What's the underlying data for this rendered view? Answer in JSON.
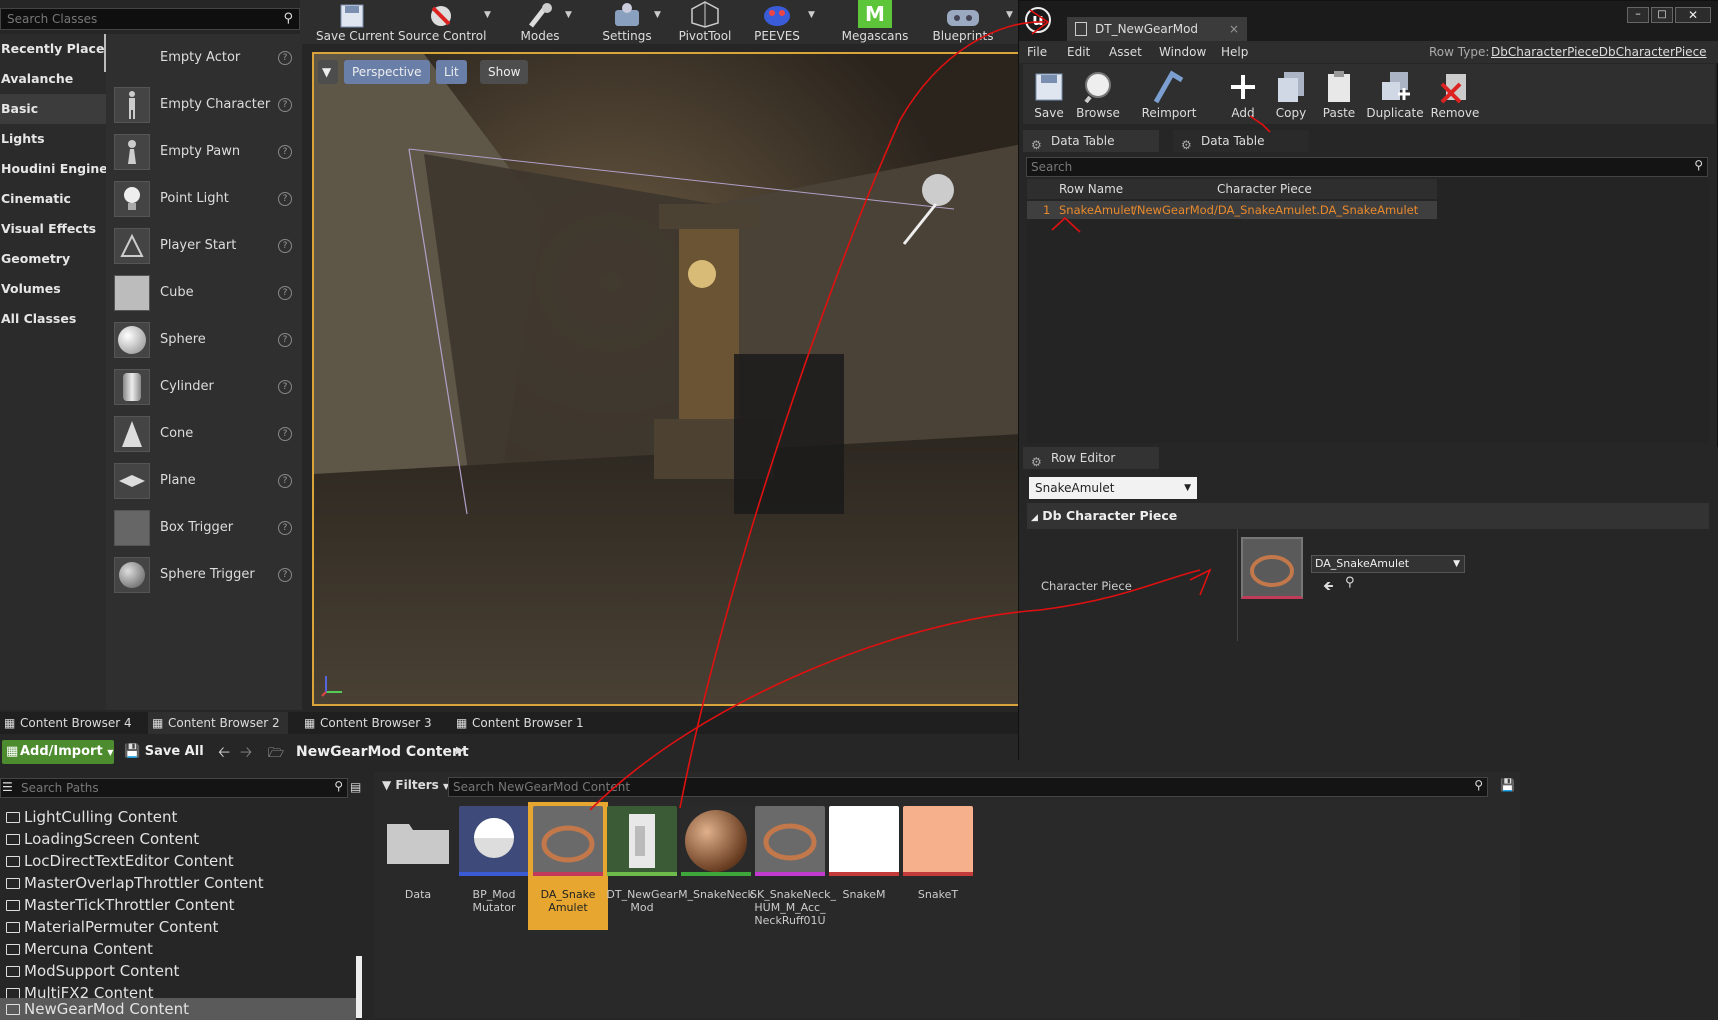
{
  "placement": {
    "search_placeholder": "Search Classes",
    "categories": [
      "Recently Placed",
      "Avalanche",
      "Basic",
      "Lights",
      "Houdini Engine",
      "Cinematic",
      "Visual Effects",
      "Geometry",
      "Volumes",
      "All Classes"
    ],
    "selected_category": "Basic",
    "items": [
      "Empty Actor",
      "Empty Character",
      "Empty Pawn",
      "Point Light",
      "Player Start",
      "Cube",
      "Sphere",
      "Cylinder",
      "Cone",
      "Plane",
      "Box Trigger",
      "Sphere Trigger"
    ]
  },
  "toolbar": {
    "save_current": "Save Current",
    "source_control": "Source Control",
    "modes": "Modes",
    "settings": "Settings",
    "pivot_tool": "PivotTool",
    "peeves": "PEEVES",
    "megascans": "Megascans",
    "blueprints": "Blueprints"
  },
  "viewport": {
    "perspective": "Perspective",
    "lit": "Lit",
    "show": "Show"
  },
  "data_table_window": {
    "tab_title": "DT_NewGearMod",
    "menus": [
      "File",
      "Edit",
      "Asset",
      "Window",
      "Help"
    ],
    "row_type_label": "Row Type:",
    "row_type_value": "DbCharacterPieceDbCharacterPiece",
    "buttons": [
      "Save",
      "Browse",
      "Reimport",
      "Add",
      "Copy",
      "Paste",
      "Duplicate",
      "Remove"
    ],
    "tab_data_table": "Data Table",
    "tab_details": "Data Table Details",
    "search_placeholder": "Search",
    "columns": [
      "Row Name",
      "Character Piece"
    ],
    "rows": [
      {
        "index": "1",
        "name": "SnakeAmulet",
        "piece": "/NewGearMod/DA_SnakeAmulet.DA_SnakeAmulet"
      }
    ],
    "row_editor_tab": "Row Editor",
    "row_editor_selected": "SnakeAmulet",
    "category": "Db Character Piece",
    "property_label": "Character Piece",
    "property_value": "DA_SnakeAmulet"
  },
  "content_browser": {
    "tabs": [
      "Content Browser 4",
      "Content Browser 2",
      "Content Browser 3",
      "Content Browser 1"
    ],
    "active_tab": "Content Browser 2",
    "add_import": "Add/Import",
    "save_all": "Save All",
    "current_path": "NewGearMod Content",
    "search_paths_placeholder": "Search Paths",
    "paths": [
      "LightCulling Content",
      "LoadingScreen Content",
      "LocDirectTextEditor Content",
      "MasterOverlapThrottler Content",
      "MasterTickThrottler Content",
      "MaterialPermuter Content",
      "Mercuna Content",
      "ModSupport Content",
      "MultiFX2 Content",
      "NewGearMod Content"
    ],
    "selected_path": "NewGearMod Content",
    "filters": "Filters",
    "search_assets_placeholder": "Search NewGearMod Content",
    "assets": [
      {
        "label": "Data",
        "kind": "folder"
      },
      {
        "label": "BP_Mod Mutator",
        "kind": "blueprint"
      },
      {
        "label": "DA_Snake Amulet",
        "kind": "data-asset"
      },
      {
        "label": "DT_NewGear Mod",
        "kind": "data-table"
      },
      {
        "label": "M_SnakeNeck",
        "kind": "material"
      },
      {
        "label": "SK_SnakeNeck_ HUM_M_Acc_ NeckRuff01U",
        "kind": "skeletal-mesh"
      },
      {
        "label": "SnakeM",
        "kind": "texture"
      },
      {
        "label": "SnakeT",
        "kind": "texture"
      }
    ],
    "selected_asset": "DA_Snake Amulet"
  },
  "colors": {
    "accent_orange": "#e6a630",
    "row_text_orange": "#e8892c",
    "annotation_red": "#e01010",
    "add_import_green": "#4d8c2e"
  }
}
